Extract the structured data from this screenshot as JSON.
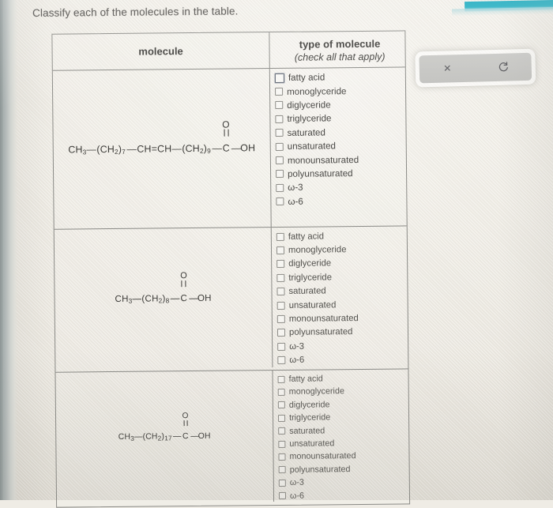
{
  "prompt": "Classify each of the molecules in the table.",
  "table": {
    "headers": {
      "molecule": "molecule",
      "type_title": "type of molecule",
      "type_subtitle": "(check all that apply)"
    },
    "rows": [
      {
        "molecule": {
          "parts": [
            "CH",
            "3",
            "—(CH",
            "2",
            ")",
            "7",
            "—CH",
            "CH—(CH",
            "2",
            ")",
            "9",
            "—",
            "C",
            "—OH"
          ],
          "plain": "CH3-(CH2)7-CH=CH-(CH2)9-C(=O)-OH",
          "chain_start": "CH",
          "chain_start_sub": "3",
          "seg1": "(CH",
          "seg1_sub": "2",
          "seg1_n": "7",
          "alkene_left": "CH",
          "alkene_right": "CH",
          "seg2": "(CH",
          "seg2_sub": "2",
          "seg2_n": "9",
          "carbonyl_o": "O",
          "carbonyl_c": "C",
          "acid": "OH"
        },
        "options": [
          {
            "label": "fatty acid",
            "checked": false,
            "focused": true
          },
          {
            "label": "monoglyceride",
            "checked": false,
            "focused": false
          },
          {
            "label": "diglyceride",
            "checked": false,
            "focused": false
          },
          {
            "label": "triglyceride",
            "checked": false,
            "focused": false
          },
          {
            "label": "saturated",
            "checked": false,
            "focused": false
          },
          {
            "label": "unsaturated",
            "checked": false,
            "focused": false
          },
          {
            "label": "monounsaturated",
            "checked": false,
            "focused": false
          },
          {
            "label": "polyunsaturated",
            "checked": false,
            "focused": false
          },
          {
            "label": "ω-3",
            "checked": false,
            "focused": false
          },
          {
            "label": "ω-6",
            "checked": false,
            "focused": false
          }
        ]
      },
      {
        "molecule": {
          "plain": "CH3-(CH2)8-C(=O)-OH",
          "chain_start": "CH",
          "chain_start_sub": "3",
          "seg1": "(CH",
          "seg1_sub": "2",
          "seg1_n": "8",
          "carbonyl_o": "O",
          "carbonyl_c": "C",
          "acid": "OH"
        },
        "options": [
          {
            "label": "fatty acid",
            "checked": false,
            "focused": false
          },
          {
            "label": "monoglyceride",
            "checked": false,
            "focused": false
          },
          {
            "label": "diglyceride",
            "checked": false,
            "focused": false
          },
          {
            "label": "triglyceride",
            "checked": false,
            "focused": false
          },
          {
            "label": "saturated",
            "checked": false,
            "focused": false
          },
          {
            "label": "unsaturated",
            "checked": false,
            "focused": false
          },
          {
            "label": "monounsaturated",
            "checked": false,
            "focused": false
          },
          {
            "label": "polyunsaturated",
            "checked": false,
            "focused": false
          },
          {
            "label": "ω-3",
            "checked": false,
            "focused": false
          },
          {
            "label": "ω-6",
            "checked": false,
            "focused": false
          }
        ]
      },
      {
        "molecule": {
          "plain": "CH3-(CH2)17-C(=O)-OH",
          "chain_start": "CH",
          "chain_start_sub": "3",
          "seg1": "(CH",
          "seg1_sub": "2",
          "seg1_n": "17",
          "carbonyl_o": "O",
          "carbonyl_c": "C",
          "acid": "OH"
        },
        "options": [
          {
            "label": "fatty acid",
            "checked": false,
            "focused": false
          },
          {
            "label": "monoglyceride",
            "checked": false,
            "focused": false
          },
          {
            "label": "diglyceride",
            "checked": false,
            "focused": false
          },
          {
            "label": "triglyceride",
            "checked": false,
            "focused": false
          },
          {
            "label": "saturated",
            "checked": false,
            "focused": false
          },
          {
            "label": "unsaturated",
            "checked": false,
            "focused": false
          },
          {
            "label": "monounsaturated",
            "checked": false,
            "focused": false
          },
          {
            "label": "polyunsaturated",
            "checked": false,
            "focused": false
          },
          {
            "label": "ω-3",
            "checked": false,
            "focused": false
          },
          {
            "label": "ω-6",
            "checked": false,
            "focused": false
          }
        ]
      }
    ]
  },
  "toolbar": {
    "clear_icon": "close-x-icon",
    "clear_label": "×",
    "reset_icon": "undo-refresh-icon"
  },
  "colors": {
    "paper": "#efece4",
    "rule": "#8a8a86",
    "text": "#4a4946",
    "accent_teal": "#15a8bd",
    "toolbar_fill": "#c6c6c3"
  }
}
